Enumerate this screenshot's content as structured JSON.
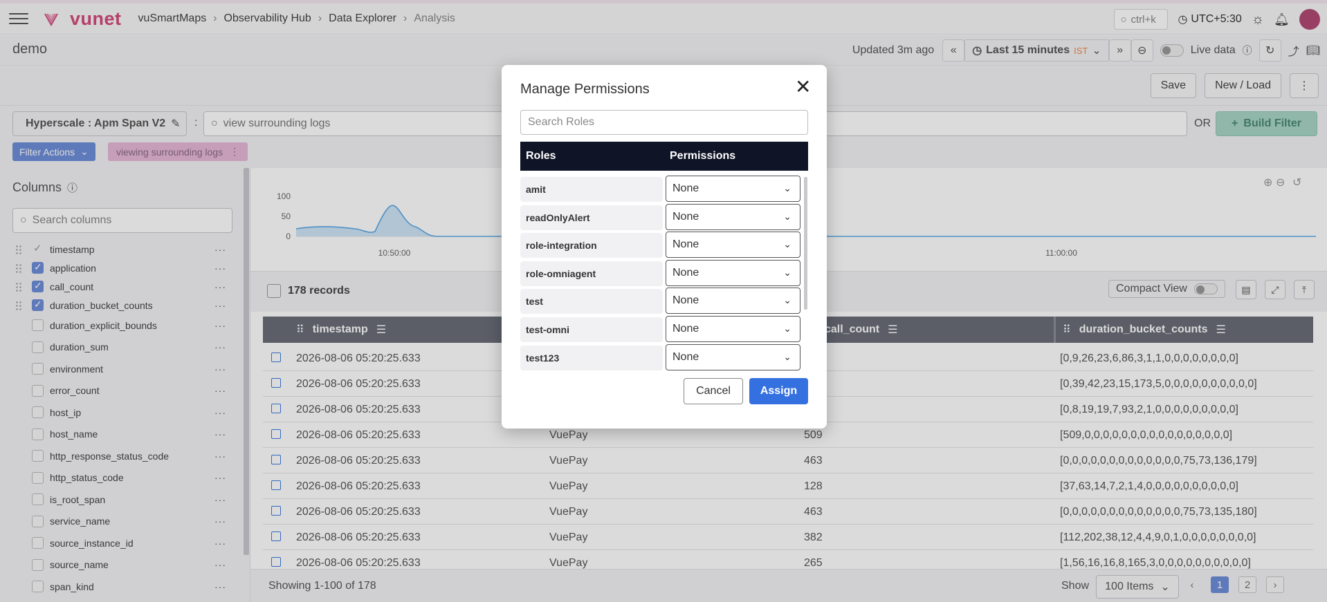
{
  "header": {
    "logo_text": "vunet",
    "breadcrumbs": [
      "vuSmartMaps",
      "Observability Hub",
      "Data Explorer",
      "Analysis"
    ],
    "search_placeholder": "ctrl+k",
    "timezone": "UTC+5:30",
    "avatar_initials": ""
  },
  "toolbar": {
    "page_title": "demo",
    "updated": "Updated 3m ago",
    "time_range": "Last 15 minutes",
    "tz_badge": "IST",
    "live_data": "Live data"
  },
  "actions": {
    "save": "Save",
    "new_load": "New / Load"
  },
  "query": {
    "index_name": "Hyperscale : Apm Span V2",
    "placeholder": "view surrounding logs",
    "or": "OR",
    "build_filter": "Build Filter",
    "filter_actions": "Filter Actions",
    "chip": "viewing surrounding logs"
  },
  "sidebar": {
    "title": "Columns",
    "search_placeholder": "Search columns",
    "columns": [
      {
        "name": "timestamp",
        "state": "locked"
      },
      {
        "name": "application",
        "state": "checked"
      },
      {
        "name": "call_count",
        "state": "checked"
      },
      {
        "name": "duration_bucket_counts",
        "state": "checked"
      },
      {
        "name": "duration_explicit_bounds",
        "state": "unchecked"
      },
      {
        "name": "duration_sum",
        "state": "unchecked"
      },
      {
        "name": "environment",
        "state": "unchecked"
      },
      {
        "name": "error_count",
        "state": "unchecked"
      },
      {
        "name": "host_ip",
        "state": "unchecked"
      },
      {
        "name": "host_name",
        "state": "unchecked"
      },
      {
        "name": "http_response_status_code",
        "state": "unchecked"
      },
      {
        "name": "http_status_code",
        "state": "unchecked"
      },
      {
        "name": "is_root_span",
        "state": "unchecked"
      },
      {
        "name": "service_name",
        "state": "unchecked"
      },
      {
        "name": "source_instance_id",
        "state": "unchecked"
      },
      {
        "name": "source_name",
        "state": "unchecked"
      },
      {
        "name": "span_kind",
        "state": "unchecked"
      }
    ]
  },
  "chart": {
    "y_ticks": [
      "100",
      "50",
      "0"
    ],
    "x_ticks": [
      "10:50:00",
      "11:00:00"
    ]
  },
  "table": {
    "records": "178 records",
    "compact_view": "Compact View",
    "headers": [
      "timestamp",
      "call_count",
      "duration_bucket_counts"
    ],
    "rows": [
      {
        "timestamp": "2026-08-06 05:20:25.633",
        "application": "",
        "call_count": "",
        "buckets": "[0,9,26,23,6,86,3,1,1,0,0,0,0,0,0,0,0]"
      },
      {
        "timestamp": "2026-08-06 05:20:25.633",
        "application": "",
        "call_count": "",
        "buckets": "[0,39,42,23,15,173,5,0,0,0,0,0,0,0,0,0,0]"
      },
      {
        "timestamp": "2026-08-06 05:20:25.633",
        "application": "",
        "call_count": "",
        "buckets": "[0,8,19,19,7,93,2,1,0,0,0,0,0,0,0,0,0]"
      },
      {
        "timestamp": "2026-08-06 05:20:25.633",
        "application": "VuePay",
        "call_count": "509",
        "buckets": "[509,0,0,0,0,0,0,0,0,0,0,0,0,0,0,0,0]"
      },
      {
        "timestamp": "2026-08-06 05:20:25.633",
        "application": "VuePay",
        "call_count": "463",
        "buckets": "[0,0,0,0,0,0,0,0,0,0,0,0,0,75,73,136,179]"
      },
      {
        "timestamp": "2026-08-06 05:20:25.633",
        "application": "VuePay",
        "call_count": "128",
        "buckets": "[37,63,14,7,2,1,4,0,0,0,0,0,0,0,0,0,0]"
      },
      {
        "timestamp": "2026-08-06 05:20:25.633",
        "application": "VuePay",
        "call_count": "463",
        "buckets": "[0,0,0,0,0,0,0,0,0,0,0,0,0,75,73,135,180]"
      },
      {
        "timestamp": "2026-08-06 05:20:25.633",
        "application": "VuePay",
        "call_count": "382",
        "buckets": "[112,202,38,12,4,4,9,0,1,0,0,0,0,0,0,0,0]"
      },
      {
        "timestamp": "2026-08-06 05:20:25.633",
        "application": "VuePay",
        "call_count": "265",
        "buckets": "[1,56,16,16,8,165,3,0,0,0,0,0,0,0,0,0,0]"
      }
    ],
    "showing": "Showing 1-100 of 178",
    "show_label": "Show",
    "items_per_page": "100 Items",
    "pages": [
      "1",
      "2"
    ],
    "current_page": "1"
  },
  "modal": {
    "title": "Manage Permissions",
    "search_placeholder": "Search Roles",
    "col_roles": "Roles",
    "col_permissions": "Permissions",
    "roles": [
      {
        "name": "amit",
        "permission": "None"
      },
      {
        "name": "readOnlyAlert",
        "permission": "None"
      },
      {
        "name": "role-integration",
        "permission": "None"
      },
      {
        "name": "role-omniagent",
        "permission": "None"
      },
      {
        "name": "test",
        "permission": "None"
      },
      {
        "name": "test-omni",
        "permission": "None"
      },
      {
        "name": "test123",
        "permission": "None"
      }
    ],
    "cancel": "Cancel",
    "assign": "Assign"
  },
  "colors": {
    "brand": "#d34a7a",
    "primary": "#3570e0",
    "table_header": "#6b6e78",
    "modal_header": "#0f1426",
    "chart_line": "#5aa8e6"
  }
}
